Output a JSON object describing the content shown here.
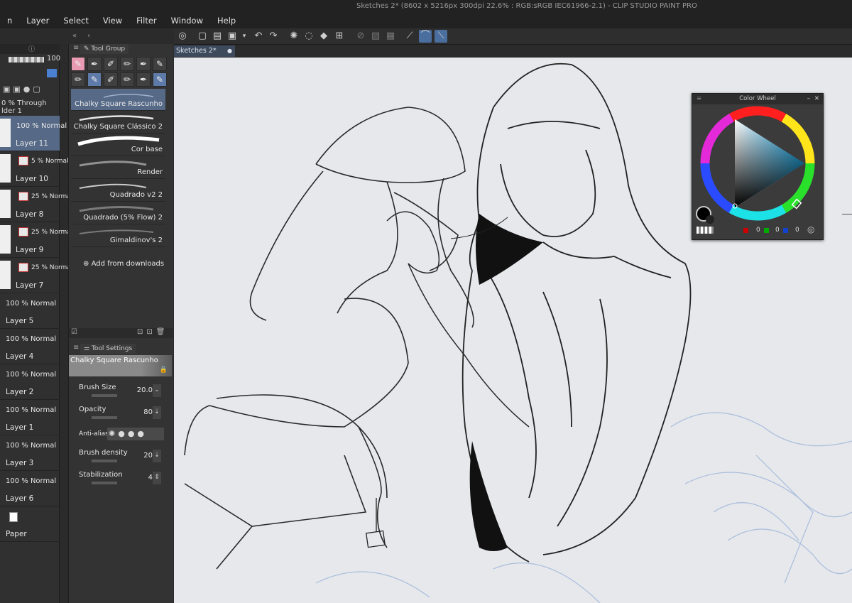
{
  "window": {
    "title": "Sketches 2* (8602 x 5216px 300dpi 22.6% : RGB:sRGB IEC61966-2.1)  - CLIP STUDIO PAINT PRO"
  },
  "menu": [
    "n",
    "Layer",
    "Select",
    "View",
    "Filter",
    "Window",
    "Help"
  ],
  "layer_panel": {
    "opacity_value": "100",
    "folder_blend": "0 % Through",
    "folder_name": "lder 1",
    "layers": [
      {
        "blend": "100 % Normal",
        "name": "Layer 11",
        "selected": true
      },
      {
        "blend": "5 % Normal",
        "name": "Layer 10"
      },
      {
        "blend": "25 % Normal",
        "name": "Layer 8"
      },
      {
        "blend": "25 % Normal",
        "name": "Layer 9"
      },
      {
        "blend": "25 % Normal",
        "name": "Layer 7"
      },
      {
        "blend": "100 % Normal",
        "name": "Layer 5"
      },
      {
        "blend": "100 % Normal",
        "name": "Layer 4"
      },
      {
        "blend": "100 % Normal",
        "name": "Layer 2"
      },
      {
        "blend": "100 % Normal",
        "name": "Layer 1"
      },
      {
        "blend": "100 % Normal",
        "name": "Layer 3"
      },
      {
        "blend": "100 % Normal",
        "name": "Layer 6"
      },
      {
        "blend": "",
        "name": "Paper"
      }
    ]
  },
  "subtool_panel": {
    "tab_label": "Tool Group",
    "brushes": [
      {
        "name": "Chalky Square Rascunho",
        "selected": true
      },
      {
        "name": "Chalky Square Clássico 2"
      },
      {
        "name": "Cor base"
      },
      {
        "name": "Render"
      },
      {
        "name": "Quadrado v2 2"
      },
      {
        "name": "Quadrado (5% Flow) 2"
      },
      {
        "name": "Gimaldinov's 2"
      }
    ],
    "add_from_downloads": "Add from downloads"
  },
  "tool_settings": {
    "tab_label": "Tool Settings",
    "brush_name": "Chalky Square Rascunho",
    "brush_size_label": "Brush Size",
    "brush_size_value": "20.0",
    "opacity_label": "Opacity",
    "opacity_value": "80",
    "anti_aliasing_label": "Anti-aliasin",
    "brush_density_label": "Brush density",
    "brush_density_value": "20",
    "stabilization_label": "Stabilization",
    "stabilization_value": "4"
  },
  "canvas": {
    "doc_tab": "Sketches 2*"
  },
  "color_wheel": {
    "title": "Color Wheel",
    "r": "0",
    "g": "0",
    "b": "0",
    "current_color": "#000000"
  },
  "colors": {
    "accent_selected": "#566a88",
    "pen_active": "#e89ab3",
    "canvas_bg": "#e6e8ec"
  }
}
